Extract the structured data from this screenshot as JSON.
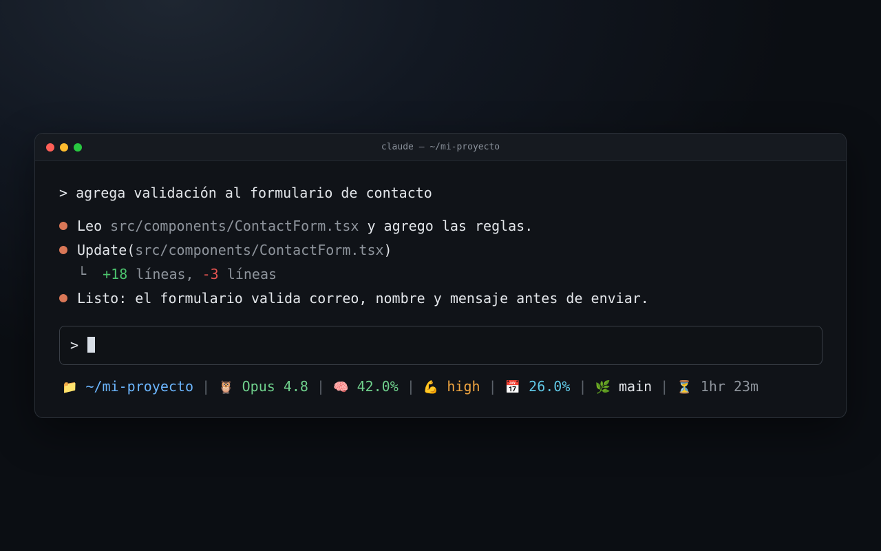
{
  "window": {
    "title": "claude — ~/mi-proyecto",
    "traffic_lights": {
      "close": "#ff5f57",
      "minimize": "#febc2e",
      "maximize": "#28c840"
    }
  },
  "transcript": {
    "user_prompt": "> agrega validación al formulario de contacto",
    "bullet_color": "#d97757",
    "entries": [
      {
        "prefix": "Leo ",
        "path": "src/components/ContactForm.tsx",
        "suffix": " y agrego las reglas."
      },
      {
        "prefix": "Update(",
        "path": "src/components/ContactForm.tsx",
        "suffix": ")"
      },
      {
        "connector": "└",
        "added": "+18",
        "added_label": " líneas, ",
        "removed": "-3",
        "removed_label": " líneas"
      },
      {
        "text": "Listo: el formulario valida correo, nombre y mensaje antes de enviar."
      }
    ]
  },
  "input": {
    "prompt": ">",
    "value": ""
  },
  "statusbar": {
    "separator": "|",
    "items": [
      {
        "icon": "folder-icon",
        "glyph": "📁",
        "text": "~/mi-proyecto",
        "color": "#6cb6ff"
      },
      {
        "icon": "owl-icon",
        "glyph": "🦉",
        "text": "Opus 4.8",
        "color": "#6fd08c"
      },
      {
        "icon": "brain-icon",
        "glyph": "🧠",
        "text": "42.0%",
        "color": "#6fd08c"
      },
      {
        "icon": "flexed-biceps-icon",
        "glyph": "💪",
        "text": "high",
        "color": "#f0a540"
      },
      {
        "icon": "calendar-icon",
        "glyph": "📅",
        "text": "26.0%",
        "color": "#5fc7e4"
      },
      {
        "icon": "herb-icon",
        "glyph": "🌿",
        "text": "main",
        "color": "#e3e6ea"
      },
      {
        "icon": "hourglass-icon",
        "glyph": "⏳",
        "text": "1hr 23m",
        "color": "#8e949c"
      }
    ]
  }
}
